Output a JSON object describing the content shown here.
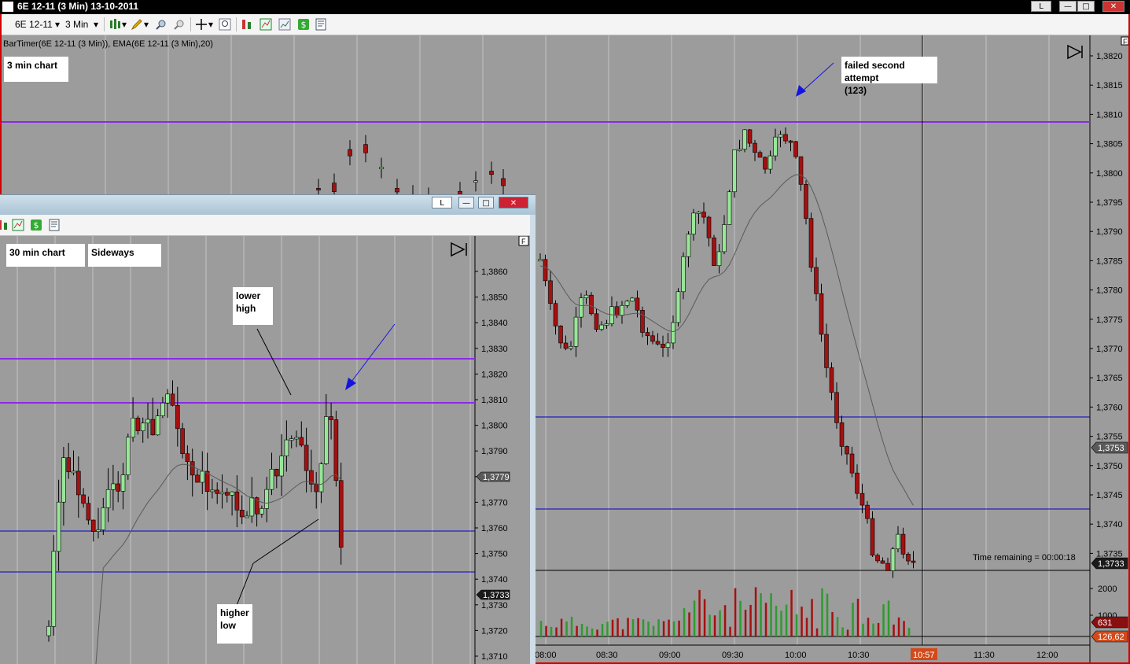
{
  "window": {
    "title": "6E 12-11 (3 Min)  13-10-2011",
    "lock_label": "L",
    "min_label": "—",
    "max_label": "□",
    "close_label": "✕"
  },
  "toolbar": {
    "instrument": "6E 12-11",
    "interval": "3 Min",
    "icons": [
      "bar-style-icon",
      "pencil-draw-icon",
      "zoom-in-icon",
      "zoom-out-icon",
      "crosshair-icon",
      "magnifier-icon",
      "strategy-icon",
      "indicator-icon",
      "chart-icon",
      "dollar-icon",
      "properties-icon"
    ]
  },
  "main_chart": {
    "indicator_label": "BarTimer(6E 12-11 (3 Min)), EMA(6E 12-11 (3 Min),20)",
    "note_chart": "3 min chart",
    "note_attempt_line1": "failed second attempt",
    "note_attempt_line2": "(123)",
    "time_remaining": "Time remaining = 00:00:18",
    "corner_label": "F",
    "price_ticks": [
      "1,3820",
      "1,3815",
      "1,3810",
      "1,3805",
      "1,3800",
      "1,3795",
      "1,3790",
      "1,3785",
      "1,3780",
      "1,3775",
      "1,3770",
      "1,3765",
      "1,3760",
      "1,3755",
      "1,3750",
      "1,3745",
      "1,3740",
      "1,3735"
    ],
    "volume_ticks": [
      "2000",
      "1000"
    ],
    "time_ticks": [
      "08:00",
      "08:30",
      "09:00",
      "09:30",
      "10:00",
      "10:30",
      "11:30",
      "12:00"
    ],
    "current_time": "10:57",
    "last_price": "1,3733",
    "marker_price": "1,3753",
    "last_volume": "631",
    "volume_ema": "126,62",
    "colors": {
      "up": "#98e698",
      "down": "#a51010",
      "purple": "#8a2be2",
      "blue": "#0000cc",
      "current_time_bg": "#d24a1a"
    }
  },
  "child_window": {
    "lock_label": "L",
    "note_chart": "30 min chart",
    "note_sideways": "Sideways",
    "note_lower_line1": "lower",
    "note_lower_line2": "high",
    "note_higher_line1": "higher",
    "note_higher_line2": "low",
    "corner_label": "F",
    "price_ticks": [
      "1,3860",
      "1,3850",
      "1,3840",
      "1,3830",
      "1,3820",
      "1,3810",
      "1,3800",
      "1,3790",
      "1,3780",
      "1,3770",
      "1,3760",
      "1,3750",
      "1,3740",
      "1,3730",
      "1,3720",
      "1,3710"
    ],
    "last_price": "1,3733",
    "marker_price": "1,3779"
  }
}
